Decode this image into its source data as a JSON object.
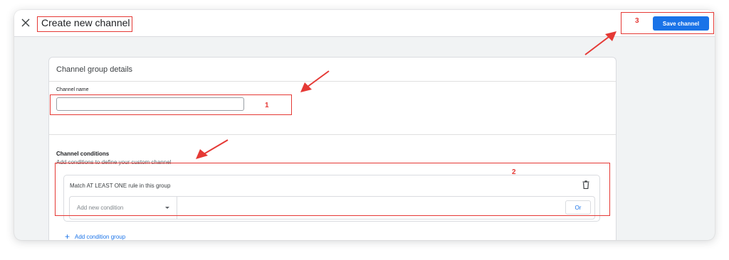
{
  "header": {
    "title": "Create new channel",
    "save_label": "Save channel"
  },
  "card": {
    "title": "Channel group details",
    "channel_name_label": "Channel name",
    "channel_name_value": "",
    "conditions_title": "Channel conditions",
    "conditions_subtitle": "Add conditions to define your custom channel",
    "group": {
      "label": "Match AT LEAST ONE rule in this group",
      "condition_placeholder": "Add new condition",
      "or_label": "Or"
    },
    "add_group_label": "Add condition group",
    "add_group_icon": "+"
  },
  "annotations": {
    "marker_1": "1",
    "marker_2": "2",
    "marker_3": "3",
    "color": "#e53935"
  },
  "colors": {
    "accent": "#1a73e8",
    "annotation": "#e53935"
  },
  "icons": [
    "close-icon",
    "trash-icon",
    "caret-down-icon",
    "plus-icon",
    "arrow-icon"
  ]
}
